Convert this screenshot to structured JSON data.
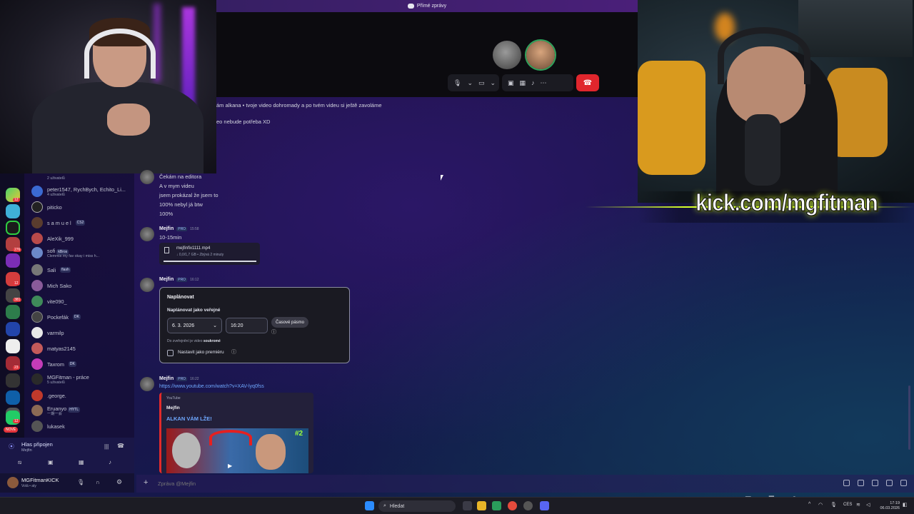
{
  "titlebar": {
    "title": "Přímé zprávy"
  },
  "call": {
    "hangup_icon": "phone-hangup-icon"
  },
  "messages_top": [
    {
      "text": "ám alkana • tvoje video dohromady a po tvém videu si ještě zavoláme"
    },
    {
      "text": "eo nebude potřeba XD"
    }
  ],
  "overlay": {
    "kick_url": "kick.com/mgfitman"
  },
  "dm_members": [
    {
      "name": "",
      "sub": "2 uživatelů"
    },
    {
      "name": "peter1547, RychBych, Echito_Li...",
      "sub": "4 uživatelů"
    },
    {
      "name": "piticko",
      "sub": ""
    },
    {
      "name": "s a m u e l",
      "tag": "CS2",
      "sub": ""
    },
    {
      "name": "AleXik_999",
      "sub": ""
    },
    {
      "name": "sofi",
      "tag": "kBros",
      "sub": "Clemmie my fav okay i miss h..."
    },
    {
      "name": "Sali",
      "tag": "flash",
      "sub": ""
    },
    {
      "name": "Mich Sako",
      "sub": ""
    },
    {
      "name": "vite090_",
      "sub": ""
    },
    {
      "name": "Pockefák",
      "tag": "DK",
      "sub": ""
    },
    {
      "name": "varmilp",
      "sub": ""
    },
    {
      "name": "matyas2145",
      "sub": ""
    },
    {
      "name": "Taxrom",
      "tag": "DK",
      "sub": ""
    },
    {
      "name": "MGFitman - práce",
      "sub": "5 uživatelů"
    },
    {
      "name": ".george.",
      "sub": ""
    },
    {
      "name": "Eruanyo",
      "tag": "HYTL",
      "sub": "一期一会"
    },
    {
      "name": "lukasek",
      "sub": ""
    }
  ],
  "rail": {
    "new_badge": "NOVÉ",
    "badges": [
      "12",
      "276",
      "12",
      "381",
      "23",
      "12"
    ]
  },
  "voice": {
    "status": "Hlas připojen",
    "channel": "Mejfin"
  },
  "user": {
    "name": "MGFitmanKICK",
    "status": "Volá • aty"
  },
  "chat": {
    "messages_block1": [
      "Čekám na editora",
      "A v mym videu",
      "jsem prokázal že jsem to",
      "100% nebyl já btw",
      "100%"
    ],
    "author": "Mejfin",
    "pro": "PRO",
    "msg2_time": "15:58",
    "msg2_text": "10-15min",
    "file_name": "mejfinfix1111.mp4",
    "file_meta": "↓ 0,0/1,7 GB • Zbývá 2 minuty",
    "msg3_time": "16:12",
    "schedule": {
      "title": "Naplánovat",
      "subtitle": "Naplánovat jako veřejné",
      "date": "6. 3. 2026",
      "time": "16:20",
      "timezone": "Časové pásmo",
      "note_prefix": "Do zveřejnění je video",
      "note_bold": "soukromé",
      "premiere": "Nastavit jako premiéru"
    },
    "msg4_time": "16:22",
    "link": "https://www.youtube.com/watch?v=XAV-lyq0fss",
    "embed_provider": "YouTube",
    "embed_author": "Mejfin",
    "embed_title": "ALKAN VÁM LŽE!",
    "thumb_badge": "#2",
    "input_placeholder": "Zpráva @Mejfin"
  },
  "taskbar": {
    "search": "Hledat",
    "lang": "CES",
    "time": "17:19",
    "date": "06.03.2026"
  }
}
